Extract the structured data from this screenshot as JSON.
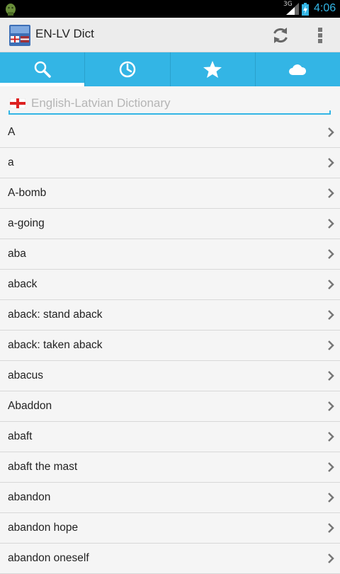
{
  "status_bar": {
    "network": "3G",
    "time": "4:06"
  },
  "app": {
    "title": "EN-LV Dict"
  },
  "tabs": [
    {
      "name": "search",
      "icon": "search-icon",
      "active": true
    },
    {
      "name": "history",
      "icon": "clock-icon",
      "active": false
    },
    {
      "name": "favorites",
      "icon": "star-icon",
      "active": false
    },
    {
      "name": "cloud",
      "icon": "cloud-icon",
      "active": false
    }
  ],
  "search": {
    "placeholder": "English-Latvian Dictionary",
    "value": ""
  },
  "words": [
    "A",
    "a",
    "A-bomb",
    "a-going",
    "aba",
    "aback",
    "aback: stand aback",
    "aback: taken aback",
    "abacus",
    "Abaddon",
    "abaft",
    "abaft the mast",
    "abandon",
    "abandon hope",
    "abandon oneself"
  ],
  "colors": {
    "accent": "#33b5e5",
    "status_bar": "#000000",
    "action_bar": "#ececec",
    "background": "#f5f5f5"
  }
}
